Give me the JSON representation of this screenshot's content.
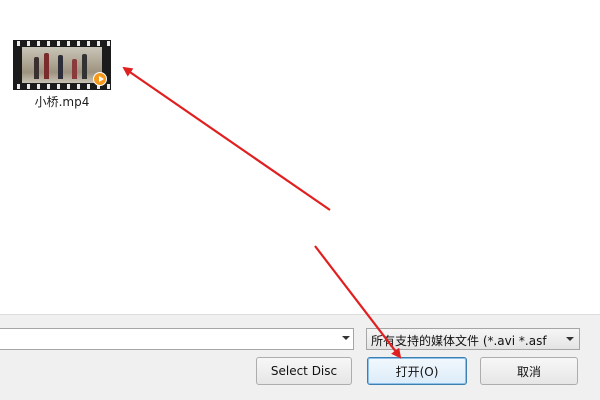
{
  "file_view": {
    "files": [
      {
        "name": "小桥.mp4",
        "icon": "video-file-thumbnail"
      }
    ]
  },
  "bottom_panel": {
    "filename_input": {
      "value": ""
    },
    "file_type_filter": {
      "selected": "所有支持的媒体文件 (*.avi *.asf"
    },
    "buttons": {
      "select_disc": "Select Disc",
      "open": "打开(O)",
      "cancel": "取消"
    }
  },
  "annotation": {
    "arrow_color": "#e02020"
  },
  "colors": {
    "panel_bg": "#f0f0f0",
    "default_button_border": "#3c7fb1",
    "play_badge": "#f39a1e"
  }
}
